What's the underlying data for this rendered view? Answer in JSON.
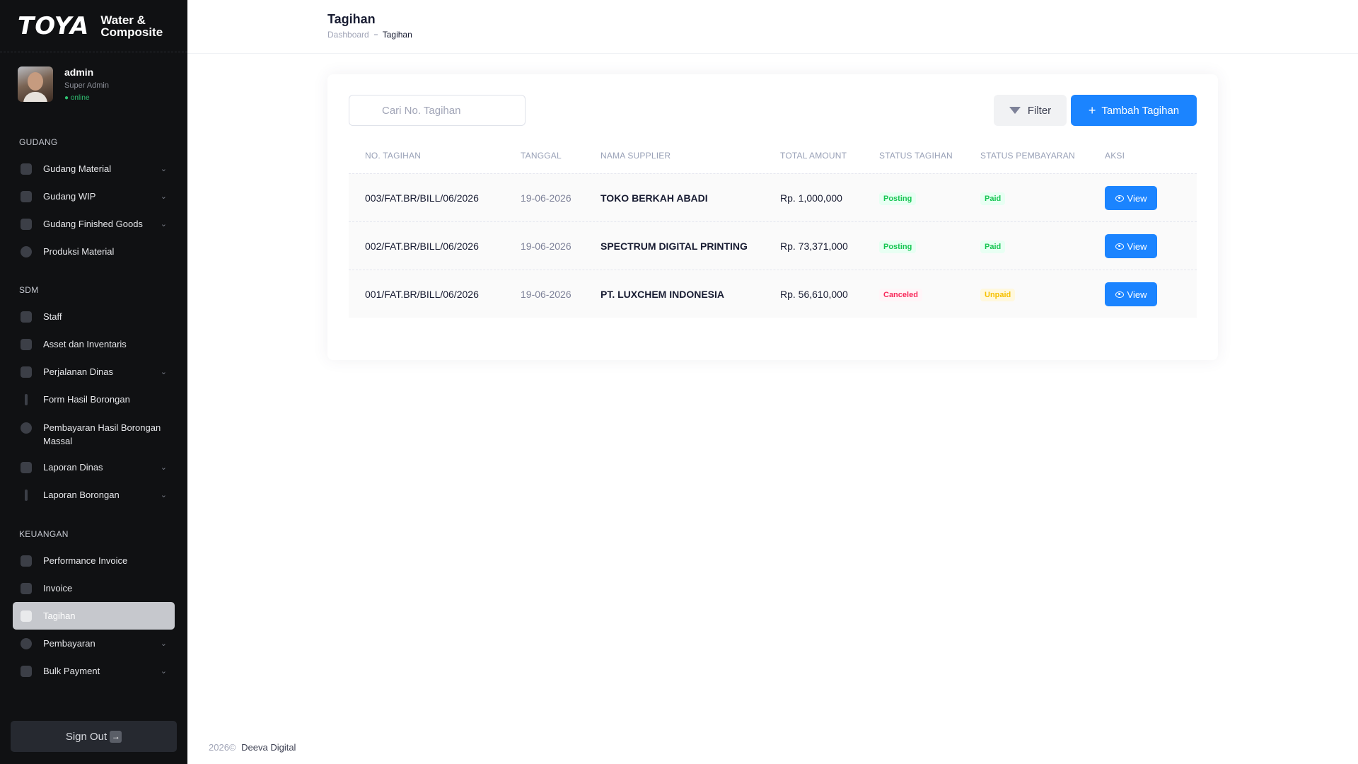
{
  "brand": {
    "logo": "TOYA",
    "line1": "Water &",
    "line2": "Composite"
  },
  "user": {
    "name": "admin",
    "role": "Super Admin",
    "status": "● online"
  },
  "sidebar": {
    "sections": [
      {
        "title": "GUDANG"
      },
      {
        "title": "SDM"
      },
      {
        "title": "KEUANGAN"
      }
    ],
    "items": [
      {
        "label": "Gudang Material"
      },
      {
        "label": "Gudang WIP"
      },
      {
        "label": "Gudang Finished Goods"
      },
      {
        "label": "Produksi Material"
      },
      {
        "label": "Staff"
      },
      {
        "label": "Asset dan Inventaris"
      },
      {
        "label": "Perjalanan Dinas"
      },
      {
        "label": "Form Hasil Borongan"
      },
      {
        "label": "Pembayaran Hasil Borongan Massal"
      },
      {
        "label": "Laporan Dinas"
      },
      {
        "label": "Laporan Borongan"
      },
      {
        "label": "Performance Invoice"
      },
      {
        "label": "Invoice"
      },
      {
        "label": "Tagihan"
      },
      {
        "label": "Pembayaran"
      },
      {
        "label": "Bulk Payment"
      }
    ],
    "signout_label": "Sign Out",
    "signout_arrow": "→"
  },
  "header": {
    "title": "Tagihan",
    "breadcrumb_home": "Dashboard",
    "breadcrumb_current": "Tagihan"
  },
  "toolbar": {
    "search_placeholder": "Cari No. Tagihan",
    "filter_label": "Filter",
    "add_label": "Tambah Tagihan"
  },
  "table": {
    "columns": [
      "NO. TAGIHAN",
      "TANGGAL",
      "NAMA SUPPLIER",
      "TOTAL AMOUNT",
      "STATUS TAGIHAN",
      "STATUS PEMBAYARAN",
      "AKSI"
    ],
    "rows": [
      {
        "no": "003/FAT.BR/BILL/06/2026",
        "date": "19-06-2026",
        "supplier": "TOKO BERKAH ABADI",
        "amount": "Rp. 1,000,000",
        "status": "Posting",
        "payment": "Paid",
        "action": "View"
      },
      {
        "no": "002/FAT.BR/BILL/06/2026",
        "date": "19-06-2026",
        "supplier": "SPECTRUM DIGITAL PRINTING",
        "amount": "Rp. 73,371,000",
        "status": "Posting",
        "payment": "Paid",
        "action": "View"
      },
      {
        "no": "001/FAT.BR/BILL/06/2026",
        "date": "19-06-2026",
        "supplier": "PT. LUXCHEM INDONESIA",
        "amount": "Rp. 56,610,000",
        "status": "Canceled",
        "payment": "Unpaid",
        "action": "View"
      }
    ]
  },
  "footer": {
    "year": "2026©",
    "company": "Deeva Digital"
  },
  "colors": {
    "primary": "#1b84ff",
    "sidebar_bg": "#101113",
    "success": "#17c653",
    "danger": "#f8285a",
    "warning": "#f6c000"
  }
}
